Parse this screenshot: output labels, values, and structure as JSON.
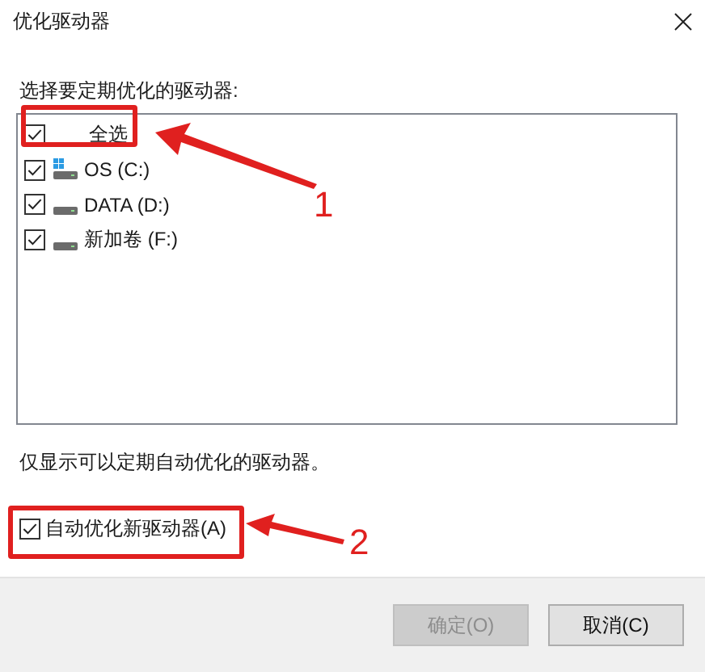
{
  "window": {
    "title": "优化驱动器"
  },
  "list_label": "选择要定期优化的驱动器:",
  "drives": [
    {
      "label": "全选",
      "kind": "all",
      "checked": true
    },
    {
      "label": "OS (C:)",
      "kind": "system",
      "checked": true
    },
    {
      "label": "DATA (D:)",
      "kind": "drive",
      "checked": true
    },
    {
      "label": "新加卷 (F:)",
      "kind": "drive",
      "checked": true
    }
  ],
  "note": "仅显示可以定期自动优化的驱动器。",
  "auto_option": {
    "label": "自动优化新驱动器(A)",
    "checked": true
  },
  "buttons": [
    {
      "label": "确定(O)",
      "disabled": true
    },
    {
      "label": "取消(C)",
      "disabled": false
    }
  ],
  "annotations": [
    {
      "label": "1"
    },
    {
      "label": "2"
    }
  ]
}
